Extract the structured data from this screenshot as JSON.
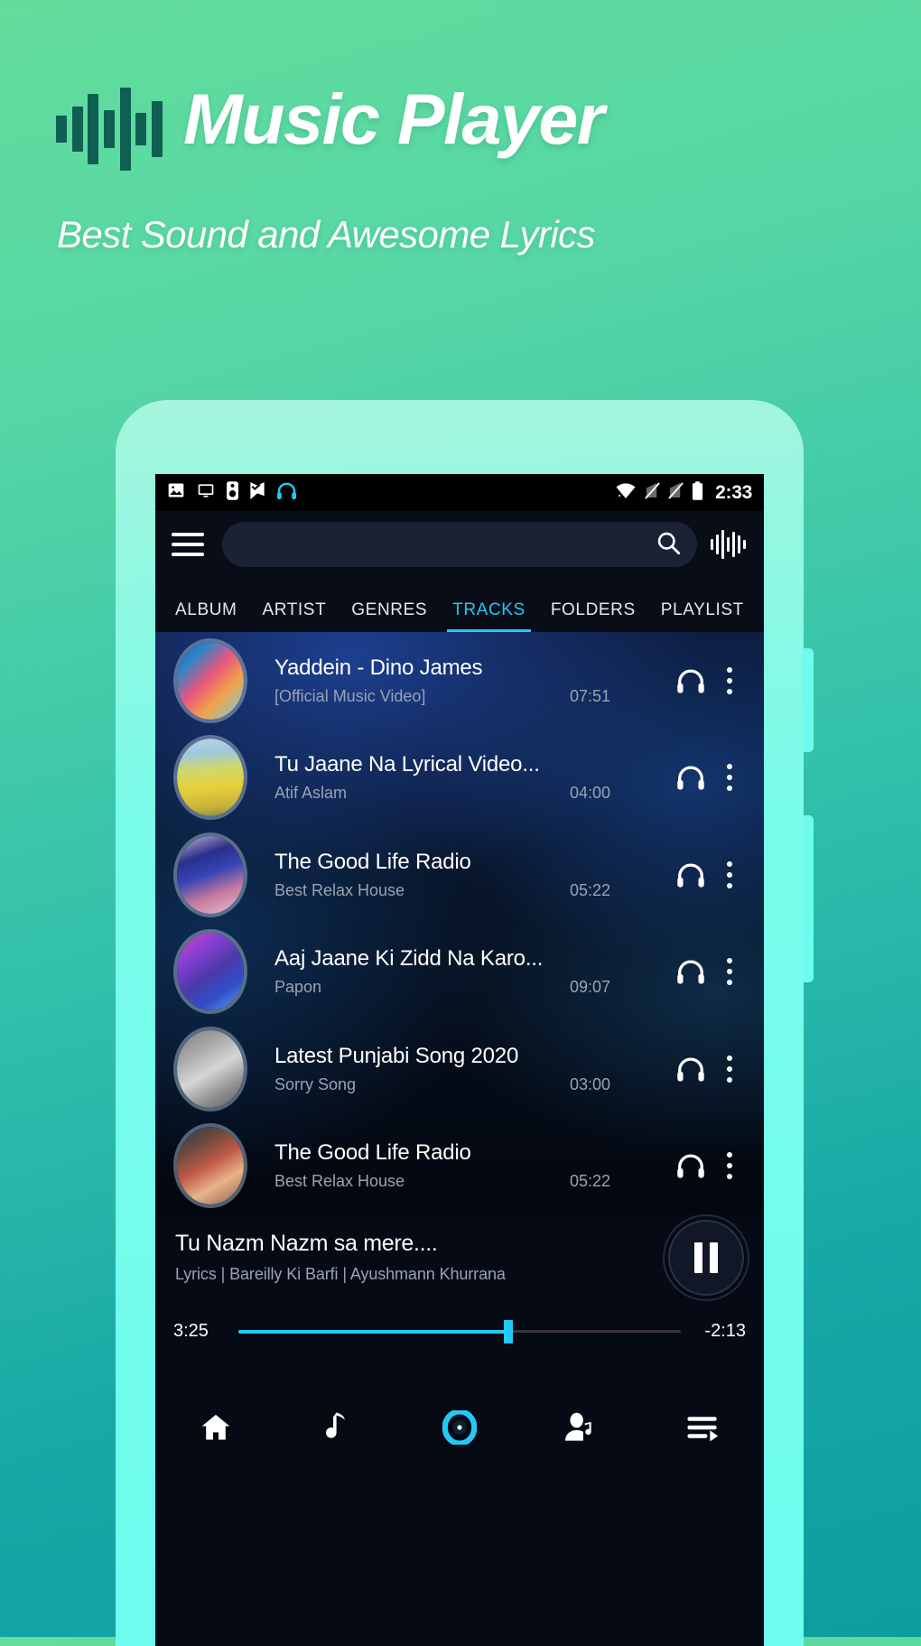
{
  "promo": {
    "title": "Music Player",
    "subtitle": "Best Sound and Awesome Lyrics",
    "logo_icon": "waveform-icon",
    "logo_bar_heights": [
      30,
      50,
      78,
      42,
      92,
      36,
      62
    ],
    "accent_dark": "#0f5f52",
    "bg_top": "#63dd9c",
    "bg_bottom": "#0c9d9e",
    "bezel": "#6efcee"
  },
  "statusbar": {
    "clock": "2:33",
    "left_icons": [
      "image-icon",
      "monitor-icon",
      "speaker-icon",
      "flag-check-icon",
      "headphones-icon"
    ],
    "right_icons": [
      "wifi-icon",
      "signal-off-icon",
      "signal-off-2-icon",
      "battery-icon"
    ],
    "headphone_color": "#23c9f5"
  },
  "toolbar": {
    "menu_icon": "hamburger-menu-icon",
    "search_value": "",
    "search_placeholder": "",
    "search_icon": "search-icon",
    "equalizer_icon": "equalizer-icon"
  },
  "tabs": {
    "active_index": 3,
    "accent": "#23c9f5",
    "items": [
      {
        "label": "ALBUM"
      },
      {
        "label": "ARTIST"
      },
      {
        "label": "GENRES"
      },
      {
        "label": "TRACKS"
      },
      {
        "label": "FOLDERS"
      },
      {
        "label": "PLAYLIST"
      }
    ]
  },
  "tracks": [
    {
      "title": "Yaddein - Dino James",
      "artist": "[Official Music Video]",
      "duration": "07:51",
      "art": "neon-portrait-two-women",
      "art_css": "linear-gradient(135deg,#1f5fa8 0%,#2a86c9 22%,#e8567f 46%,#f0a24a 68%,#6fd2e8 100%)"
    },
    {
      "title": "Tu Jaane Na Lyrical Video...",
      "artist": "Atif Aslam",
      "duration": "04:00",
      "art": "yellow-flower-field",
      "art_css": "linear-gradient(175deg,#b9d6e8 0%,#9fc7dd 20%,#cfd86a 40%,#e8cf3a 62%,#c7b23a 86%,#7f8a3c 100%)"
    },
    {
      "title": "The Good Life Radio",
      "artist": "Best Relax House",
      "duration": "05:22",
      "art": "woman-with-blue-hat",
      "art_css": "linear-gradient(160deg,#c9bcd6 0%,#2a2f8a 28%,#3644b5 48%,#c87aa0 72%,#e8c0ce 100%)"
    },
    {
      "title": "Aaj Jaane Ki Zidd Na Karo...",
      "artist": "Papon",
      "duration": "09:07",
      "art": "person-with-headphones-neon",
      "art_css": "linear-gradient(145deg,#d946b8 0%,#8a3fd4 26%,#4a3aa8 52%,#2f4fc9 74%,#5fa8e8 100%)"
    },
    {
      "title": "Latest Punjabi Song 2020",
      "artist": "Sorry Song",
      "duration": "03:00",
      "art": "grayscale-girl-stairs",
      "art_css": "linear-gradient(150deg,#7d7d7d 0%,#a8a8a8 28%,#d6d6d6 52%,#8f8f8f 76%,#5c5c5c 100%)"
    },
    {
      "title": "The Good Life Radio",
      "artist": "Best Relax House",
      "duration": "05:22",
      "art": "couple-winter-lights",
      "art_css": "linear-gradient(150deg,#2a3a5c 0%,#6a4a3c 26%,#c05a48 48%,#e8b48a 70%,#8a5a4a 100%)"
    }
  ],
  "row_icons": {
    "headphones": "headphones-icon",
    "overflow": "more-vertical-icon"
  },
  "nowplaying": {
    "title": "Tu Nazm Nazm sa mere....",
    "subtitle": "Lyrics | Bareilly Ki Barfi | Ayushmann Khurrana",
    "time_current": "3:25",
    "time_remaining": "-2:13",
    "progress_percent": 61,
    "play_state_icon": "pause-icon",
    "accent": "#23c9f5"
  },
  "bottomnav": {
    "active_index": 2,
    "accent": "#23c9f5",
    "items": [
      {
        "icon": "home-icon",
        "label": "Home"
      },
      {
        "icon": "music-note-icon",
        "label": "Songs"
      },
      {
        "icon": "disc-icon",
        "label": "Now Playing"
      },
      {
        "icon": "artist-icon",
        "label": "Artists"
      },
      {
        "icon": "queue-icon",
        "label": "Playlist"
      }
    ]
  }
}
